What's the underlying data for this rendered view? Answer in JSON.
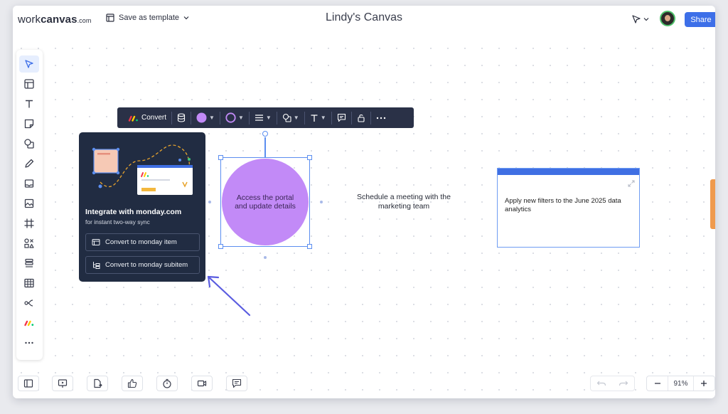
{
  "app": {
    "logo_regular": "work",
    "logo_bold": "canvas",
    "logo_suffix": ".com",
    "save_template_label": "Save as template",
    "canvas_title": "Lindy's Canvas",
    "share_label": "Share"
  },
  "object_toolbar": {
    "convert_label": "Convert",
    "fill_color": "#c28af7",
    "stroke_color": "#c28af7"
  },
  "integration_popup": {
    "title": "Integrate with monday.com",
    "subtitle": "for instant two-way sync",
    "convert_item_label": "Convert to monday item",
    "convert_subitem_label": "Convert to monday subitem"
  },
  "canvas": {
    "circle_text": "Access the portal and update details",
    "note_text": "Schedule a meeting with the marketing team",
    "card_text": "Apply new filters to the June 2025 data analytics"
  },
  "zoom": {
    "level": "91%"
  },
  "colors": {
    "accent": "#3d6fe8",
    "toolbar_bg": "#2a3147",
    "popup_bg": "#212c42",
    "shape_fill": "#c28af7",
    "card_header": "#3f6fe3",
    "side_tab": "#ef9a4d"
  }
}
